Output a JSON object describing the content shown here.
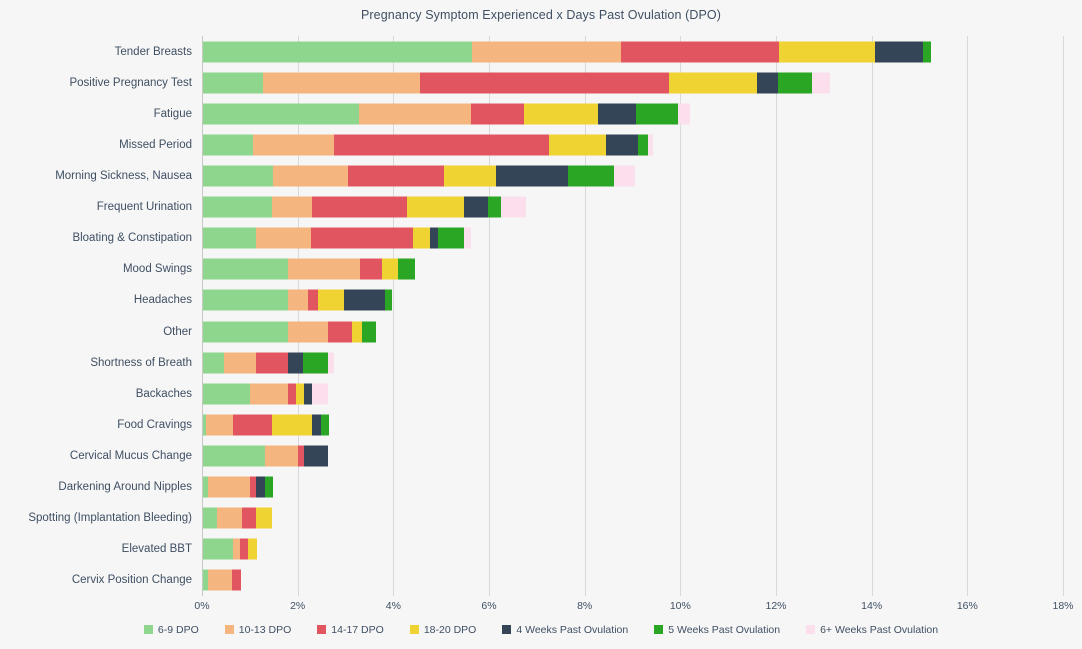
{
  "chart_data": {
    "type": "bar",
    "title": "Pregnancy Symptom Experienced x Days Past Ovulation (DPO)",
    "xlabel": "",
    "ylabel": "",
    "orientation": "horizontal",
    "stacked": true,
    "grid": true,
    "legend_position": "bottom",
    "xlim": [
      0,
      18
    ],
    "xticks": [
      "0%",
      "2%",
      "4%",
      "6%",
      "8%",
      "10%",
      "12%",
      "14%",
      "16%",
      "18%"
    ],
    "xtick_values": [
      0,
      2,
      4,
      6,
      8,
      10,
      12,
      14,
      16,
      18
    ],
    "unit": "%",
    "categories": [
      "Tender Breasts",
      "Positive Pregnancy Test",
      "Fatigue",
      "Missed Period",
      "Morning Sickness, Nausea",
      "Frequent Urination",
      "Bloating & Constipation",
      "Mood Swings",
      "Headaches",
      "Other",
      "Shortness of Breath",
      "Backaches",
      "Food Cravings",
      "Cervical Mucus Change",
      "Darkening Around Nipples",
      "Spotting (Implantation Bleeding)",
      "Elevated BBT",
      "Cervix Position Change"
    ],
    "series": [
      {
        "name": "6-9 DPO",
        "color": "#8ed68e",
        "values": [
          5.65,
          1.28,
          3.29,
          1.07,
          1.48,
          1.46,
          1.13,
          1.8,
          1.8,
          1.8,
          0.46,
          1.0,
          0.08,
          1.32,
          0.13,
          0.31,
          0.65,
          0.13
        ]
      },
      {
        "name": "10-13 DPO",
        "color": "#f5b57f",
        "values": [
          3.12,
          3.28,
          2.34,
          1.69,
          1.57,
          0.84,
          1.15,
          1.5,
          0.42,
          0.84,
          0.67,
          0.79,
          0.57,
          0.69,
          0.88,
          0.52,
          0.15,
          0.5
        ]
      },
      {
        "name": "14-17 DPO",
        "color": "#e15561"
      },
      {
        "name": "18-20 DPO",
        "color": "#eed333"
      },
      {
        "name": "4 Weeks Past Ovulation",
        "color": "#344558"
      },
      {
        "name": "5 Weeks Past Ovulation",
        "color": "#2aa524"
      },
      {
        "name": "6+ Weeks Past Ovulation",
        "color": "#fbdfec"
      }
    ],
    "rows": [
      {
        "category": "Tender Breasts",
        "values": [
          5.65,
          3.12,
          3.3,
          2.01,
          1.0,
          0.17,
          0.0
        ],
        "total": 15.25
      },
      {
        "category": "Positive Pregnancy Test",
        "values": [
          1.28,
          3.28,
          5.21,
          1.84,
          0.44,
          0.71,
          0.38
        ],
        "total": 13.14
      },
      {
        "category": "Fatigue",
        "values": [
          3.29,
          2.34,
          1.11,
          1.54,
          0.8,
          0.88,
          0.25
        ],
        "total": 10.21
      },
      {
        "category": "Missed Period",
        "values": [
          1.07,
          1.69,
          4.5,
          1.19,
          0.67,
          0.21,
          0.1
        ],
        "total": 9.43
      },
      {
        "category": "Morning Sickness, Nausea",
        "values": [
          1.48,
          1.57,
          2.01,
          1.09,
          1.51,
          0.96,
          0.44
        ],
        "total": 9.06
      },
      {
        "category": "Frequent Urination",
        "values": [
          1.46,
          0.84,
          1.99,
          1.19,
          0.5,
          0.27,
          0.52
        ],
        "total": 6.77
      },
      {
        "category": "Bloating & Constipation",
        "values": [
          1.13,
          1.15,
          2.13,
          0.36,
          0.17,
          0.54,
          0.15
        ],
        "total": 5.63
      },
      {
        "category": "Mood Swings",
        "values": [
          1.8,
          1.5,
          0.46,
          0.34,
          0.0,
          0.35,
          0.0
        ],
        "total": 4.45
      },
      {
        "category": "Headaches",
        "values": [
          1.8,
          0.42,
          0.21,
          0.54,
          0.86,
          0.14,
          0.0
        ],
        "total": 3.97
      },
      {
        "category": "Other",
        "values": [
          1.8,
          0.84,
          0.5,
          0.21,
          0.0,
          0.29,
          0.0
        ],
        "total": 3.64
      },
      {
        "category": "Shortness of Breath",
        "values": [
          0.46,
          0.67,
          0.67,
          0.0,
          0.31,
          0.52,
          0.13
        ],
        "total": 2.76
      },
      {
        "category": "Backaches",
        "values": [
          1.0,
          0.79,
          0.17,
          0.17,
          0.17,
          0.0,
          0.33
        ],
        "total": 2.63
      },
      {
        "category": "Food Cravings",
        "values": [
          0.08,
          0.57,
          0.82,
          0.84,
          0.17,
          0.17,
          0.0
        ],
        "total": 2.63
      },
      {
        "category": "Cervical Mucus Change",
        "values": [
          1.32,
          0.69,
          0.13,
          0.0,
          0.5,
          0.0,
          0.0
        ],
        "total": 2.63
      },
      {
        "category": "Darkening Around Nipples",
        "values": [
          0.13,
          0.88,
          0.13,
          0.0,
          0.17,
          0.17,
          0.0
        ],
        "total": 1.46
      },
      {
        "category": "Spotting (Implantation Bleeding)",
        "values": [
          0.31,
          0.52,
          0.3,
          0.33,
          0.0,
          0.0,
          0.0
        ],
        "total": 1.46
      },
      {
        "category": "Elevated BBT",
        "values": [
          0.65,
          0.15,
          0.17,
          0.19,
          0.0,
          0.0,
          0.0
        ],
        "total": 1.15
      },
      {
        "category": "Cervix Position Change",
        "values": [
          0.13,
          0.5,
          0.19,
          0.0,
          0.0,
          0.0,
          0.0
        ],
        "total": 0.82
      }
    ]
  }
}
